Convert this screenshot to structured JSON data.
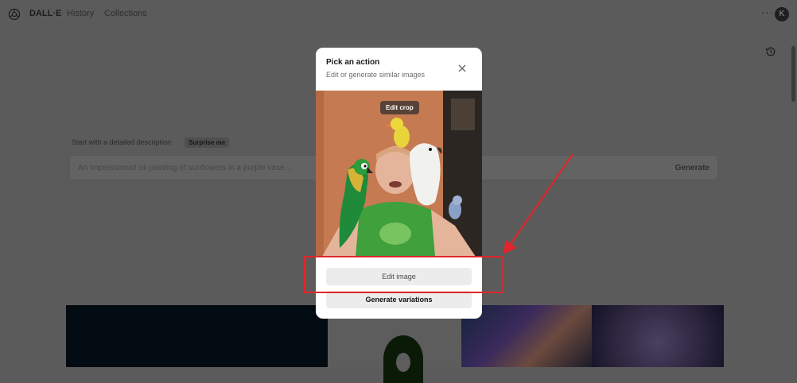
{
  "header": {
    "brand": "DALL·E",
    "nav": [
      "History",
      "Collections"
    ],
    "more_label": "···",
    "avatar_initial": "K"
  },
  "prompt": {
    "label": "Start with a detailed description",
    "surprise_label": "Surprise me",
    "placeholder": "An Impressionist oil painting of sunflowers in a purple vase…",
    "generate_label": "Generate"
  },
  "modal": {
    "title": "Pick an action",
    "subtitle": "Edit or generate similar images",
    "edit_crop_label": "Edit crop",
    "edit_image_label": "Edit image",
    "variations_label": "Generate variations"
  },
  "annotation": {
    "color": "#e0262c"
  },
  "icons": {
    "logo": "openai-logo-icon",
    "history": "history-clock-icon",
    "close": "close-icon"
  }
}
